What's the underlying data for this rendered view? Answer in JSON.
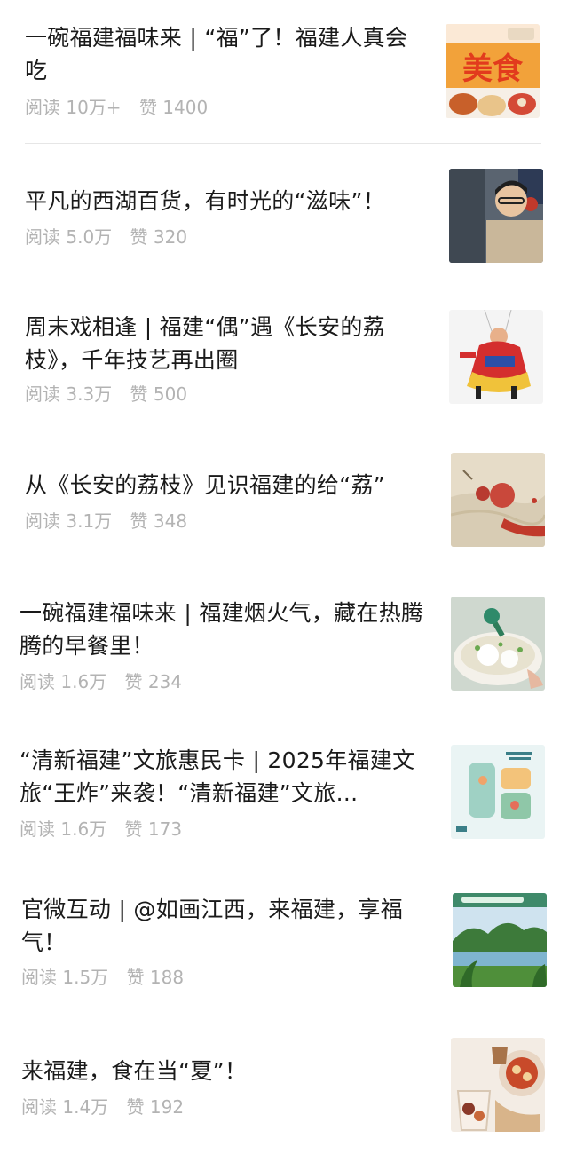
{
  "articles": [
    {
      "title": "一碗福建福味来 | “福”了！福建人真会吃",
      "read_label": "阅读",
      "read_count": "10万+",
      "like_label": "赞",
      "like_count": "1400",
      "thumb": {
        "caption": "美食",
        "icon": "food-thumbnail-icon"
      }
    },
    {
      "title": "平凡的西湖百货，有时光的“滋味”！",
      "read_label": "阅读",
      "read_count": "5.0万",
      "like_label": "赞",
      "like_count": "320",
      "thumb": {
        "icon": "shopkeeper-photo-icon"
      }
    },
    {
      "title": "周末戏相逢 | 福建“偶”遇《长安的荔枝》，千年技艺再出圈",
      "read_label": "阅读",
      "read_count": "3.3万",
      "like_label": "赞",
      "like_count": "500",
      "thumb": {
        "icon": "marionette-photo-icon"
      }
    },
    {
      "title": "从《长安的荔枝》见识福建的给“荔”",
      "read_label": "阅读",
      "read_count": "3.1万",
      "like_label": "赞",
      "like_count": "348",
      "thumb": {
        "icon": "lychee-painting-icon"
      }
    },
    {
      "title": "一碗福建福味来 | 福建烟火气，藏在热腾腾的早餐里！",
      "read_label": "阅读",
      "read_count": "1.6万",
      "like_label": "赞",
      "like_count": "234",
      "thumb": {
        "icon": "breakfast-bowl-icon"
      }
    },
    {
      "title": "“清新福建”文旅惠民卡 | 2025年福建文旅“王炸”来袭！“清新福建”文旅...",
      "read_label": "阅读",
      "read_count": "1.6万",
      "like_label": "赞",
      "like_count": "173",
      "thumb": {
        "icon": "fu-character-map-icon"
      }
    },
    {
      "title": "官微互动 | @如画江西，来福建，享福气！",
      "read_label": "阅读",
      "read_count": "1.5万",
      "like_label": "赞",
      "like_count": "188",
      "thumb": {
        "icon": "landscape-photo-icon"
      }
    },
    {
      "title": "来福建，食在当“夏”！",
      "read_label": "阅读",
      "read_count": "1.4万",
      "like_label": "赞",
      "like_count": "192",
      "thumb": {
        "icon": "summer-food-photo-icon"
      }
    }
  ]
}
